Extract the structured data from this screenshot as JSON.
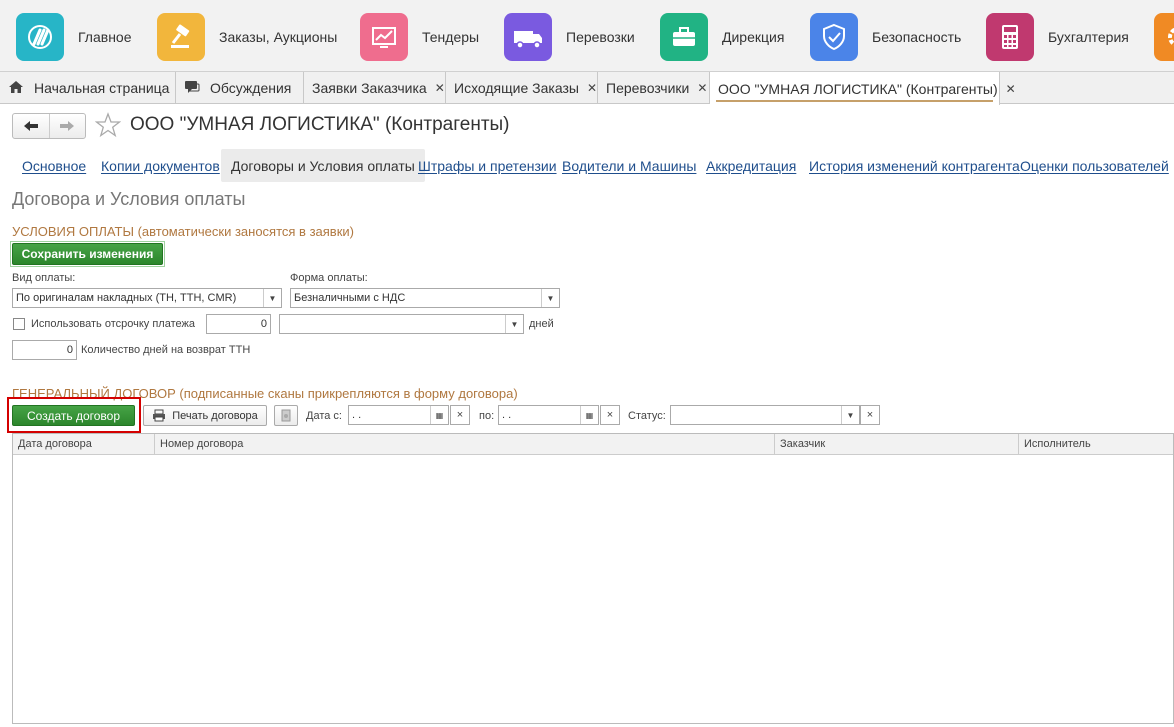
{
  "sections": [
    {
      "label": "Главное",
      "icon": "dollar-swirl-icon",
      "color": "#27b5c7"
    },
    {
      "label": "Заказы, Аукционы",
      "icon": "gavel-icon",
      "color": "#f2b63c"
    },
    {
      "label": "Тендеры",
      "icon": "chart-icon",
      "color": "#ef6d8e"
    },
    {
      "label": "Перевозки",
      "icon": "truck-icon",
      "color": "#7a5ae0"
    },
    {
      "label": "Дирекция",
      "icon": "briefcase-icon",
      "color": "#21b384"
    },
    {
      "label": "Безопасность",
      "icon": "shield-icon",
      "color": "#4b84e8"
    },
    {
      "label": "Бухгалтерия",
      "icon": "calculator-icon",
      "color": "#c0396f"
    }
  ],
  "tabs": [
    {
      "label": "Начальная страница"
    },
    {
      "label": "Обсуждения"
    },
    {
      "label": "Заявки Заказчика"
    },
    {
      "label": "Исходящие Заказы"
    },
    {
      "label": "Перевозчики"
    },
    {
      "label": "ООО \"УМНАЯ ЛОГИСТИКА\" (Контрагенты)"
    }
  ],
  "page_title": "ООО \"УМНАЯ ЛОГИСТИКА\" (Контрагенты)",
  "section_nav": [
    {
      "label": "Основное"
    },
    {
      "label": "Копии документов"
    },
    {
      "label": "Договоры и Условия оплаты"
    },
    {
      "label": "Штрафы и претензии"
    },
    {
      "label": "Водители и Машины"
    },
    {
      "label": "Аккредитация"
    },
    {
      "label": "История изменений контрагента"
    },
    {
      "label": "Оценки пользователей"
    }
  ],
  "heading": "Договора и Условия оплаты",
  "payment": {
    "group_title": "УСЛОВИЯ ОПЛАТЫ (автоматически заносятся в заявки)",
    "save_label": "Сохранить изменения",
    "type_label": "Вид оплаты:",
    "type_value": "По оригиналам накладных (ТН, ТТН, CMR)",
    "form_label": "Форма оплаты:",
    "form_value": "Безналичными с НДС",
    "deferral_label": "Использовать отсрочку платежа",
    "deferral_checked": false,
    "deferral_value": "0",
    "deferral_days_value": "",
    "days_label": "дней",
    "return_value": "0",
    "return_label": "Количество дней на возврат ТТН"
  },
  "contract": {
    "group_title": "ГЕНЕРАЛЬНЫЙ ДОГОВОР (подписанные сканы прикрепляются в форму договора)",
    "create_label": "Создать договор",
    "print_label": "Печать договора",
    "date_from_label": "Дата с:",
    "date_from_value": " .  . ",
    "date_to_label": "по:",
    "date_to_value": " .  . ",
    "status_label": "Статус:",
    "status_value": "",
    "clear_glyph": "×",
    "columns": [
      "Дата договора",
      "Номер договора",
      "Заказчик",
      "Исполнитель"
    ]
  }
}
